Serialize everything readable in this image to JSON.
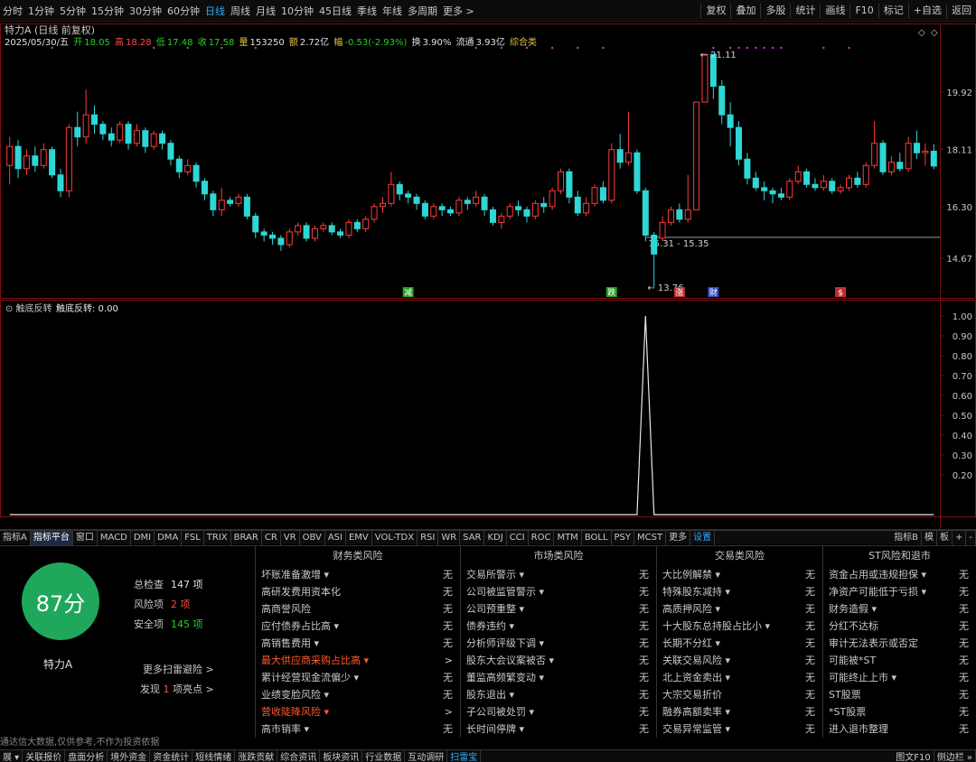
{
  "toolbar": {
    "periods": [
      "分时",
      "1分钟",
      "5分钟",
      "15分钟",
      "30分钟",
      "60分钟",
      "日线",
      "周线",
      "月线",
      "10分钟",
      "45日线",
      "季线",
      "年线",
      "多周期",
      "更多 >"
    ],
    "active_period": "日线",
    "right_buttons": [
      "复权",
      "叠加",
      "多股",
      "统计",
      "画线",
      "F10",
      "标记",
      "+自选",
      "返回"
    ]
  },
  "stock": {
    "title": "特力A (日线 前复权)",
    "date": "2025/05/30/五",
    "open_label": "开",
    "open": "18.05",
    "high_label": "高",
    "high": "18.28",
    "low_label": "低",
    "low": "17.48",
    "close_label": "收",
    "close": "17.58",
    "vol_label": "量",
    "vol": "153250",
    "amount_label": "额",
    "amount": "2.72亿",
    "change_label": "幅",
    "change": "-0.53(-2.93%)",
    "turnover_label": "换",
    "turnover": "3.90%",
    "float_label": "流通",
    "float": "3.93亿",
    "category": "综合类"
  },
  "colors": {
    "up": "#ff3b3b",
    "down": "#2fd6d6",
    "bg": "#000000",
    "grid": "#7a1010",
    "score": "#1fa85c",
    "hot": "#ff5a2a"
  },
  "chart_data": [
    {
      "type": "candlestick",
      "title": "特力A (日线 前复权)",
      "y_ticks": [
        "19.92",
        "18.11",
        "16.30",
        "14.67"
      ],
      "ylim": [
        13.5,
        22.0
      ],
      "annotations": {
        "high_label": "21.11",
        "low_label": "13.76",
        "range_label": "15.31 - 15.35"
      },
      "event_markers": [
        "减",
        "跌",
        "涨",
        "财",
        "$"
      ],
      "x_ticks": [
        "2024年",
        "12",
        "1",
        "2",
        "3",
        "4",
        "5"
      ],
      "candles": [
        [
          17.6,
          18.2,
          17.0,
          18.5
        ],
        [
          18.2,
          17.5,
          17.2,
          18.4
        ],
        [
          17.5,
          17.9,
          17.3,
          18.1
        ],
        [
          17.9,
          17.6,
          17.4,
          18.2
        ],
        [
          17.6,
          18.1,
          17.5,
          18.3
        ],
        [
          18.1,
          17.3,
          17.2,
          18.2
        ],
        [
          17.3,
          16.8,
          16.6,
          17.5
        ],
        [
          16.8,
          18.8,
          16.6,
          18.9
        ],
        [
          18.8,
          18.5,
          18.2,
          19.3
        ],
        [
          18.5,
          19.2,
          18.3,
          20.0
        ],
        [
          19.2,
          18.9,
          18.6,
          19.5
        ],
        [
          18.9,
          18.6,
          18.4,
          19.0
        ],
        [
          18.6,
          18.4,
          18.2,
          18.8
        ],
        [
          18.4,
          18.9,
          18.3,
          19.0
        ],
        [
          18.9,
          18.3,
          18.1,
          19.0
        ],
        [
          18.3,
          18.7,
          18.2,
          18.9
        ],
        [
          18.7,
          18.2,
          18.0,
          18.8
        ],
        [
          18.2,
          18.6,
          18.1,
          18.7
        ],
        [
          18.6,
          18.3,
          18.1,
          18.7
        ],
        [
          18.3,
          17.8,
          17.6,
          18.4
        ],
        [
          17.8,
          17.4,
          17.2,
          17.9
        ],
        [
          17.4,
          17.6,
          17.3,
          17.8
        ],
        [
          17.6,
          17.1,
          16.9,
          17.7
        ],
        [
          17.1,
          16.7,
          16.5,
          17.2
        ],
        [
          16.7,
          16.2,
          16.0,
          16.8
        ],
        [
          16.2,
          16.5,
          16.0,
          16.9
        ],
        [
          16.5,
          16.4,
          16.3,
          16.6
        ],
        [
          16.4,
          16.6,
          16.3,
          16.7
        ],
        [
          16.6,
          16.0,
          15.9,
          16.7
        ],
        [
          16.0,
          15.5,
          15.3,
          16.1
        ],
        [
          15.5,
          15.4,
          15.2,
          15.6
        ],
        [
          15.4,
          15.3,
          15.1,
          15.5
        ],
        [
          15.3,
          15.1,
          14.9,
          15.4
        ],
        [
          15.1,
          15.5,
          15.0,
          15.6
        ],
        [
          15.5,
          15.7,
          15.4,
          15.8
        ],
        [
          15.7,
          15.3,
          15.2,
          15.8
        ],
        [
          15.3,
          15.6,
          15.2,
          15.7
        ],
        [
          15.6,
          15.7,
          15.5,
          15.8
        ],
        [
          15.7,
          15.5,
          15.4,
          15.8
        ],
        [
          15.5,
          15.4,
          15.3,
          15.6
        ],
        [
          15.4,
          15.8,
          15.3,
          15.9
        ],
        [
          15.8,
          15.6,
          15.5,
          15.9
        ],
        [
          15.6,
          15.9,
          15.5,
          16.0
        ],
        [
          15.9,
          16.3,
          15.8,
          16.4
        ],
        [
          16.3,
          16.4,
          16.1,
          16.6
        ],
        [
          16.4,
          17.0,
          16.3,
          17.4
        ],
        [
          17.0,
          16.7,
          16.5,
          17.1
        ],
        [
          16.7,
          16.6,
          16.4,
          16.8
        ],
        [
          16.6,
          16.4,
          16.2,
          16.7
        ],
        [
          16.4,
          16.0,
          15.9,
          16.5
        ],
        [
          16.0,
          16.3,
          15.9,
          16.4
        ],
        [
          16.3,
          16.2,
          16.0,
          16.4
        ],
        [
          16.2,
          16.1,
          16.0,
          16.3
        ],
        [
          16.1,
          16.5,
          16.0,
          16.6
        ],
        [
          16.5,
          16.4,
          16.2,
          16.6
        ],
        [
          16.4,
          16.6,
          16.3,
          16.8
        ],
        [
          16.6,
          16.2,
          16.0,
          16.7
        ],
        [
          16.2,
          15.8,
          15.7,
          16.3
        ],
        [
          15.8,
          16.0,
          15.6,
          16.1
        ],
        [
          16.0,
          16.3,
          15.9,
          16.4
        ],
        [
          16.3,
          16.2,
          16.0,
          16.5
        ],
        [
          16.2,
          16.0,
          15.8,
          16.3
        ],
        [
          16.0,
          16.4,
          15.9,
          16.5
        ],
        [
          16.4,
          16.3,
          16.1,
          16.6
        ],
        [
          16.3,
          16.8,
          16.2,
          16.9
        ],
        [
          16.8,
          17.4,
          16.7,
          17.5
        ],
        [
          17.4,
          16.6,
          16.4,
          17.5
        ],
        [
          16.6,
          16.1,
          16.0,
          16.8
        ],
        [
          16.1,
          16.4,
          16.0,
          16.6
        ],
        [
          16.4,
          16.9,
          16.3,
          17.0
        ],
        [
          16.9,
          16.5,
          16.4,
          17.1
        ],
        [
          16.5,
          18.1,
          16.4,
          18.3
        ],
        [
          18.1,
          17.7,
          17.5,
          18.6
        ],
        [
          17.7,
          18.0,
          17.6,
          19.3
        ],
        [
          18.0,
          16.8,
          16.7,
          18.1
        ],
        [
          16.8,
          15.4,
          15.2,
          16.9
        ],
        [
          15.4,
          14.8,
          13.76,
          15.5
        ],
        [
          15.3,
          15.8,
          15.2,
          16.0
        ],
        [
          15.8,
          16.2,
          15.7,
          16.3
        ],
        [
          16.2,
          15.9,
          15.8,
          16.4
        ],
        [
          15.9,
          16.2,
          15.8,
          17.3
        ],
        [
          16.2,
          19.6,
          16.2,
          19.6
        ],
        [
          19.6,
          21.11,
          19.6,
          21.11
        ],
        [
          21.11,
          20.1,
          19.7,
          21.11
        ],
        [
          20.1,
          19.2,
          18.9,
          20.3
        ],
        [
          19.2,
          18.8,
          18.2,
          19.6
        ],
        [
          18.8,
          17.8,
          17.6,
          19.0
        ],
        [
          17.8,
          17.2,
          17.0,
          18.0
        ],
        [
          17.2,
          16.9,
          16.8,
          17.4
        ],
        [
          16.9,
          16.8,
          16.5,
          17.1
        ],
        [
          16.8,
          16.7,
          16.4,
          16.9
        ],
        [
          16.7,
          16.6,
          16.5,
          16.9
        ],
        [
          16.6,
          17.1,
          16.5,
          17.2
        ],
        [
          17.1,
          17.4,
          17.0,
          17.6
        ],
        [
          17.4,
          17.0,
          16.9,
          17.5
        ],
        [
          17.0,
          16.9,
          16.8,
          17.2
        ],
        [
          16.9,
          17.1,
          16.8,
          17.3
        ],
        [
          17.1,
          16.8,
          16.7,
          17.2
        ],
        [
          16.8,
          16.9,
          16.7,
          17.0
        ],
        [
          16.9,
          17.2,
          16.8,
          17.3
        ],
        [
          17.2,
          17.0,
          16.9,
          17.4
        ],
        [
          17.0,
          17.6,
          16.9,
          17.7
        ],
        [
          17.6,
          18.3,
          17.5,
          19.0
        ],
        [
          18.3,
          17.4,
          17.3,
          18.4
        ],
        [
          17.4,
          17.7,
          17.3,
          17.9
        ],
        [
          17.7,
          17.5,
          17.4,
          18.0
        ],
        [
          17.5,
          18.3,
          17.4,
          18.5
        ],
        [
          18.3,
          18.0,
          17.8,
          18.7
        ],
        [
          18.0,
          18.05,
          17.6,
          18.3
        ],
        [
          18.05,
          17.58,
          17.48,
          18.28
        ]
      ]
    },
    {
      "type": "line",
      "title": "触底反转",
      "series_name": "触底反转",
      "current_value": "0.00",
      "y_ticks": [
        "1.00",
        "0.90",
        "0.80",
        "0.70",
        "0.60",
        "0.50",
        "0.40",
        "0.30",
        "0.20"
      ],
      "ylim": [
        0,
        1
      ],
      "values_note": "all 0 except one spike",
      "spike_index": 75,
      "spike_value": 1.0,
      "count": 110
    }
  ],
  "indicator_tabs": [
    "指标A",
    "指标平台",
    "窗口",
    "MACD",
    "DMI",
    "DMA",
    "FSL",
    "TRIX",
    "BRAR",
    "CR",
    "VR",
    "OBV",
    "ASI",
    "EMV",
    "VOL-TDX",
    "RSI",
    "WR",
    "SAR",
    "KDJ",
    "CCI",
    "ROC",
    "MTM",
    "BOLL",
    "PSY",
    "MCST",
    "更多",
    "设置"
  ],
  "indicator_tabs_right": [
    "指标B",
    "模",
    "板",
    "+",
    "-"
  ],
  "indicator_label": "触底反转",
  "indicator_value_text": "触底反转: 0.00",
  "right_label": "日线",
  "scan": {
    "score": "87分",
    "stock_name": "特力A",
    "total_label": "总检查",
    "total": "147 项",
    "risk_label": "风险项",
    "risk": "2 项",
    "safe_label": "安全项",
    "safe": "145 项",
    "more": "更多扫雷避险 >",
    "found_pre": "发现",
    "found_num": "1",
    "found_post": "项亮点 >",
    "disclaimer": "通达信大数据,仅供参考,不作为投资依据"
  },
  "risk_columns": [
    {
      "title": "财务类风险",
      "rows": [
        {
          "label": "坏账准备激增 ▾",
          "v": "无"
        },
        {
          "label": "高研发费用资本化",
          "v": "无"
        },
        {
          "label": "高商誉风险",
          "v": "无"
        },
        {
          "label": "应付债券占比高 ▾",
          "v": "无"
        },
        {
          "label": "高销售费用 ▾",
          "v": "无"
        },
        {
          "label": "最大供应商采购占比高 ▾",
          "v": ">",
          "hot": true
        },
        {
          "label": "累计经营现金流偏少 ▾",
          "v": "无"
        },
        {
          "label": "业绩变脸风险 ▾",
          "v": "无"
        },
        {
          "label": "营收陡降风险 ▾",
          "v": ">",
          "hot": true
        },
        {
          "label": "高市销率 ▾",
          "v": "无"
        }
      ]
    },
    {
      "title": "市场类风险",
      "rows": [
        {
          "label": "交易所警示 ▾",
          "v": "无"
        },
        {
          "label": "公司被监管警示 ▾",
          "v": "无"
        },
        {
          "label": "公司预重整 ▾",
          "v": "无"
        },
        {
          "label": "债券违约 ▾",
          "v": "无"
        },
        {
          "label": "分析师评级下调 ▾",
          "v": "无"
        },
        {
          "label": "股东大会议案被否 ▾",
          "v": "无"
        },
        {
          "label": "董监高频繁变动 ▾",
          "v": "无"
        },
        {
          "label": "股东退出 ▾",
          "v": "无"
        },
        {
          "label": "子公司被处罚 ▾",
          "v": "无"
        },
        {
          "label": "长时间停牌 ▾",
          "v": "无"
        }
      ]
    },
    {
      "title": "交易类风险",
      "rows": [
        {
          "label": "大比例解禁 ▾",
          "v": "无"
        },
        {
          "label": "特殊股东减持 ▾",
          "v": "无"
        },
        {
          "label": "高质押风险 ▾",
          "v": "无"
        },
        {
          "label": "十大股东总持股占比小 ▾",
          "v": "无"
        },
        {
          "label": "长期不分红 ▾",
          "v": "无"
        },
        {
          "label": "关联交易风险 ▾",
          "v": "无"
        },
        {
          "label": "北上资金卖出 ▾",
          "v": "无"
        },
        {
          "label": "大宗交易折价",
          "v": "无"
        },
        {
          "label": "融券高额卖率 ▾",
          "v": "无"
        },
        {
          "label": "交易异常监管 ▾",
          "v": "无"
        }
      ]
    },
    {
      "title": "ST风险和退市",
      "rows": [
        {
          "label": "资金占用或违规担保 ▾",
          "v": "无"
        },
        {
          "label": "净资产可能低于亏损 ▾",
          "v": "无"
        },
        {
          "label": "财务造假 ▾",
          "v": "无"
        },
        {
          "label": "分红不达标",
          "v": "无"
        },
        {
          "label": "审计无法表示或否定",
          "v": "无"
        },
        {
          "label": "可能被*ST",
          "v": "无"
        },
        {
          "label": "可能终止上市 ▾",
          "v": "无"
        },
        {
          "label": "ST股票",
          "v": "无"
        },
        {
          "label": "*ST股票",
          "v": "无"
        },
        {
          "label": "进入退市整理",
          "v": "无"
        }
      ]
    }
  ],
  "statusbar": {
    "items": [
      "展 ▾",
      "关联报价",
      "盘面分析",
      "境外资金",
      "资金统计",
      "短线情绪",
      "涨跌贡献",
      "综合资讯",
      "板块资讯",
      "行业数据",
      "互动调研",
      "扫雷宝"
    ],
    "active": "扫雷宝",
    "right": [
      "图文F10",
      "侧边栏 »"
    ]
  }
}
